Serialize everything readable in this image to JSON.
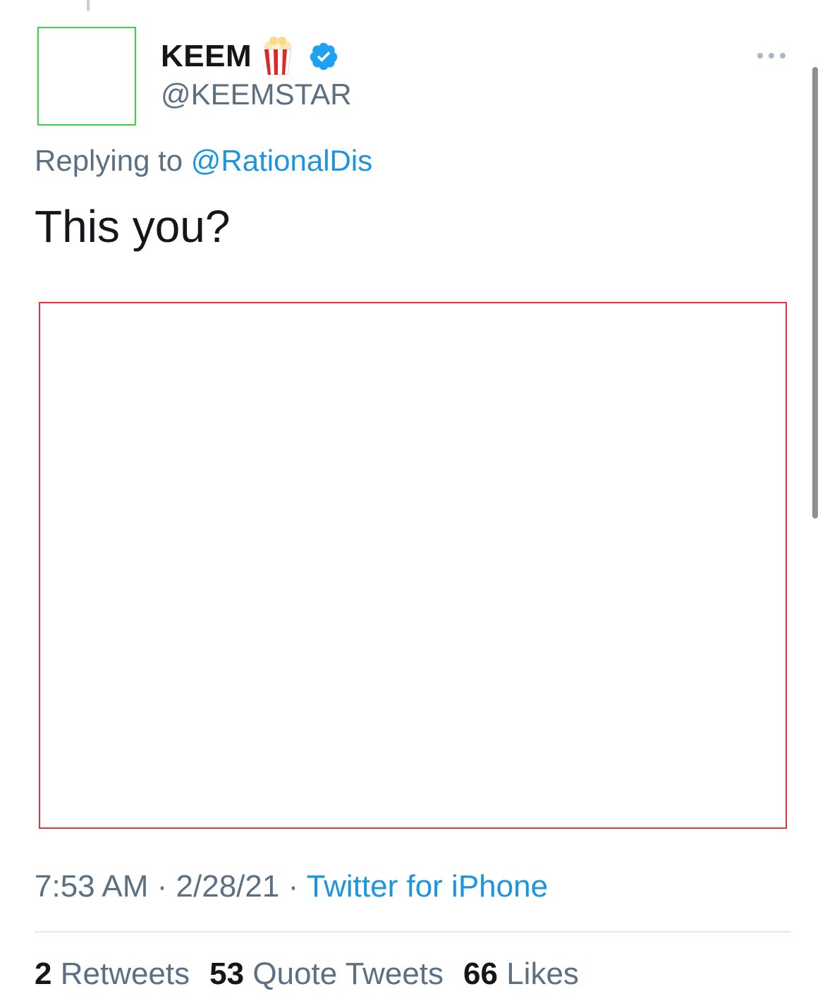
{
  "author": {
    "display_name": "KEEM",
    "emoji_icon": "popcorn-icon",
    "verified_icon": "verified-badge-icon",
    "handle": "@KEEMSTAR"
  },
  "menu": {
    "icon": "more-horizontal-icon"
  },
  "reply": {
    "prefix": "Replying to",
    "handle": "@RationalDis"
  },
  "tweet": {
    "text": "This you?"
  },
  "meta": {
    "time": "7:53 AM",
    "separator": " · ",
    "date": "2/28/21",
    "source": "Twitter for iPhone"
  },
  "stats": {
    "retweets_count": "2",
    "retweets_label": "Retweets",
    "quotes_count": "53",
    "quotes_label": "Quote Tweets",
    "likes_count": "66",
    "likes_label": "Likes"
  },
  "colors": {
    "link": "#1b95e0",
    "secondary_text": "#5b7083",
    "primary_text": "#14171a",
    "verified": "#1da1f2"
  }
}
